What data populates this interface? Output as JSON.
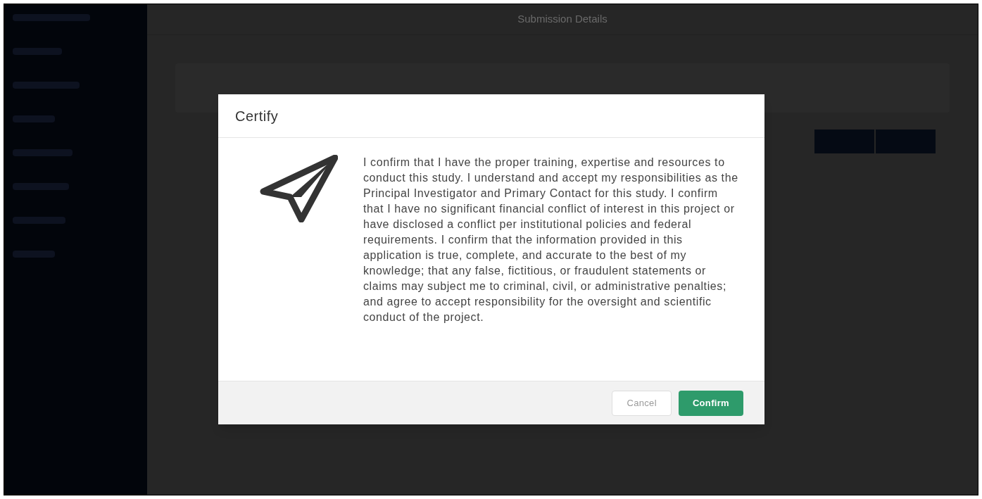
{
  "page": {
    "title": "Submission Details"
  },
  "dialog": {
    "title": "Certify",
    "message": "I confirm that I have the proper training, expertise and resources to conduct this study. I understand and accept my responsibilities as the Principal Investigator and Primary Contact for this study. I confirm that I have no significant financial conflict of interest in this project or have disclosed a conflict per institutional policies and federal requirements. I confirm that the information provided in this application is true, complete, and accurate to the best of my knowledge; that any false, fictitious, or fraudulent statements or claims may subject me to criminal, civil, or administrative penalties; and agree to accept responsibility for the oversight and scientific conduct of the project.",
    "buttons": [
      {
        "label": "Cancel",
        "kind": "secondary"
      },
      {
        "label": "Confirm",
        "kind": "primary"
      }
    ]
  }
}
